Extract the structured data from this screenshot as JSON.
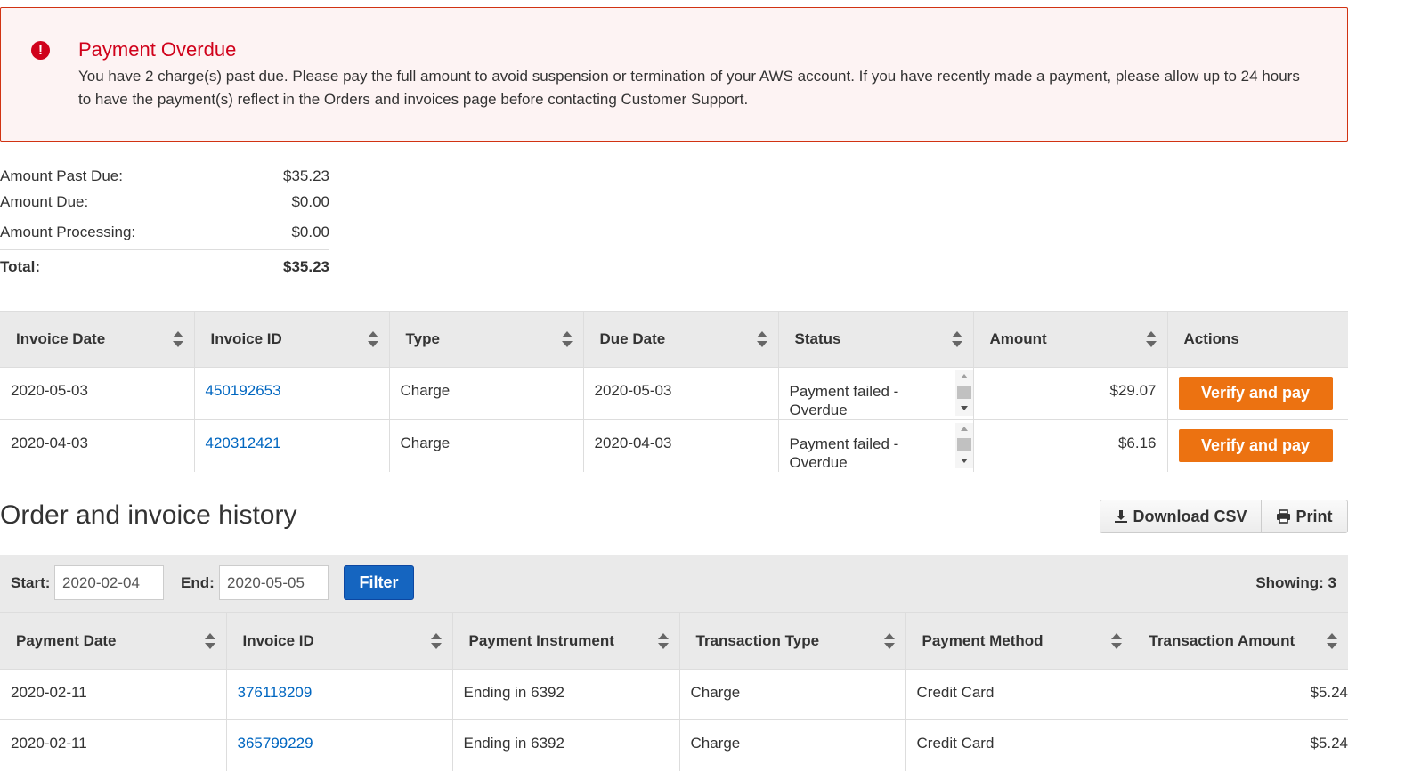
{
  "alert": {
    "title": "Payment Overdue",
    "icon": "exclamation-circle-icon",
    "message": "You have 2 charge(s) past due. Please pay the full amount to avoid suspension or termination of your AWS account. If you have recently made a payment, please allow up to 24 hours to have the payment(s) reflect in the Orders and invoices page before contacting Customer Support."
  },
  "summary": {
    "past_due_label": "Amount Past Due:",
    "past_due_value": "$35.23",
    "due_label": "Amount Due:",
    "due_value": "$0.00",
    "processing_label": "Amount Processing:",
    "processing_value": "$0.00",
    "total_label": "Total:",
    "total_value": "$35.23"
  },
  "invoices": {
    "headers": [
      "Invoice Date",
      "Invoice ID",
      "Type",
      "Due Date",
      "Status",
      "Amount",
      "Actions"
    ],
    "rows": [
      {
        "invoice_date": "2020-05-03",
        "invoice_id": "450192653",
        "type": "Charge",
        "due_date": "2020-05-03",
        "status": "Payment failed - Overdue",
        "amount": "$29.07",
        "action": "Verify and pay"
      },
      {
        "invoice_date": "2020-04-03",
        "invoice_id": "420312421",
        "type": "Charge",
        "due_date": "2020-04-03",
        "status": "Payment failed - Overdue",
        "amount": "$6.16",
        "action": "Verify and pay"
      }
    ]
  },
  "history": {
    "title": "Order and invoice history",
    "download_label": "Download CSV",
    "print_label": "Print",
    "start_label": "Start:",
    "start_value": "2020-02-04",
    "end_label": "End:",
    "end_value": "2020-05-05",
    "filter_label": "Filter",
    "showing": "Showing: 3",
    "headers": [
      "Payment Date",
      "Invoice ID",
      "Payment Instrument",
      "Transaction Type",
      "Payment Method",
      "Transaction Amount"
    ],
    "rows": [
      {
        "payment_date": "2020-02-11",
        "invoice_id": "376118209",
        "instrument": "Ending in 6392",
        "transaction_type": "Charge",
        "method": "Credit Card",
        "amount": "$5.24"
      },
      {
        "payment_date": "2020-02-11",
        "invoice_id": "365799229",
        "instrument": "Ending in 6392",
        "transaction_type": "Charge",
        "method": "Credit Card",
        "amount": "$5.24"
      }
    ]
  },
  "colors": {
    "alert_red": "#d0021b",
    "action_orange": "#ec7211",
    "link_blue": "#0066c0",
    "filter_blue": "#1565c0"
  }
}
